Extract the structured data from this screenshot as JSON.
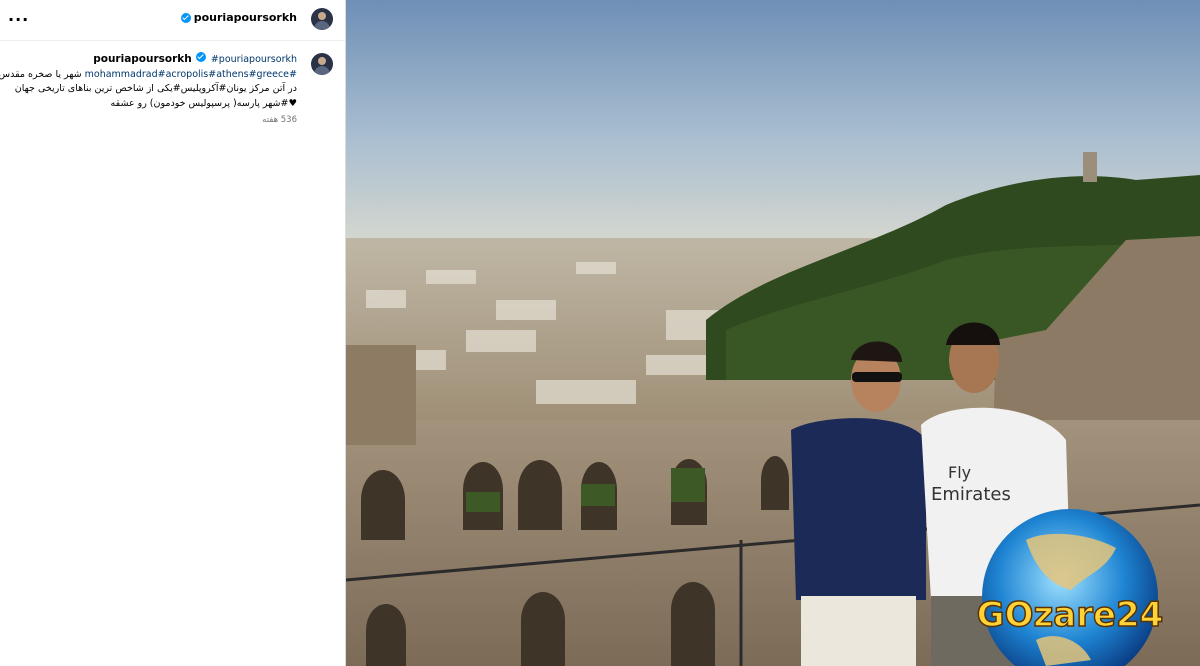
{
  "post": {
    "more_label": "...",
    "username": "pouriapoursorkh",
    "caption": {
      "username": "pouriapoursorkh",
      "tag_self": "#pouriapoursorkh",
      "line2": "شهر یا صخره مقدس #",
      "line3_tags": "#mohammadrad#acropolis#athens#greece",
      "line4": "در آتن مرکز یونان#آکروپلیس#یکی از شاخص ترین بناهای تاریخی جهان",
      "line5": "♥#شهر پارسه( پرسپولیس خودمون) رو عشقه"
    },
    "timestamp": "536 هفته"
  },
  "image": {
    "shirt_brand": "Fly",
    "shirt_brand2": "Emirates",
    "watermark": "GOzare24"
  },
  "colors": {
    "verified": "#0095f6",
    "hashtag": "#00376b",
    "watermark": "#ffd23a"
  },
  "icons": [
    "more-icon",
    "verified-icon",
    "avatar"
  ]
}
